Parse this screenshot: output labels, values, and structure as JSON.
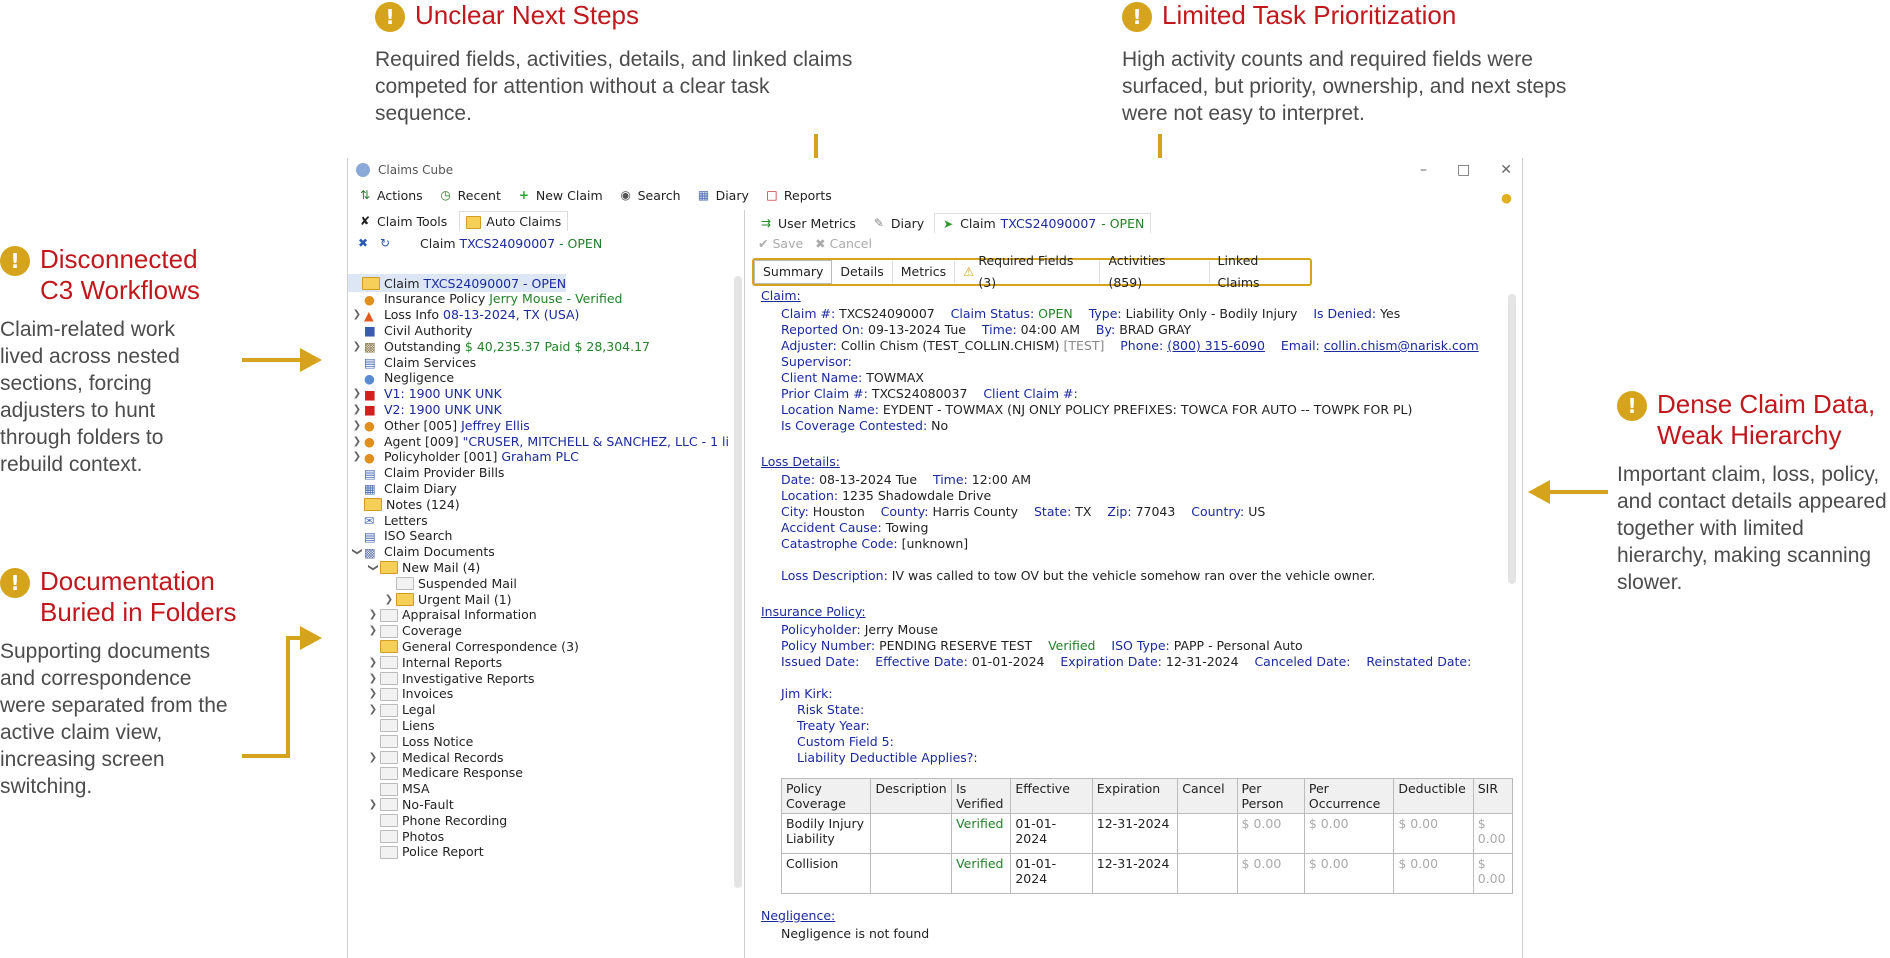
{
  "colors": {
    "accent": "#d5a31c",
    "annot_title": "#c0181c",
    "link": "#1a2a9c",
    "ok": "#24802a"
  },
  "annotations": {
    "unclear": {
      "title": "Unclear Next Steps",
      "desc": "Required fields, activities, details, and linked claims competed for attention without a clear task sequence."
    },
    "limited": {
      "title": "Limited Task Prioritization",
      "desc": "High activity counts and required fields were surfaced, but priority, ownership, and next steps were not easy to interpret."
    },
    "disconnected": {
      "title_1": "Disconnected",
      "title_2": "C3 Workflows",
      "desc": "Claim-related work lived across nested sections, forcing adjusters to hunt through folders to rebuild context."
    },
    "documentation": {
      "title_1": "Documentation",
      "title_2": "Buried in Folders",
      "desc": "Supporting documents and correspondence were separated from the active claim view, increasing screen switching."
    },
    "dense": {
      "title_1": "Dense Claim Data,",
      "title_2": "Weak Hierarchy",
      "desc": "Important claim, loss, policy, and contact details appeared together with limited hierarchy, making scanning slower."
    }
  },
  "window": {
    "title": "Claims Cube"
  },
  "toolbar": {
    "actions": "Actions",
    "recent": "Recent",
    "new_claim": "New Claim",
    "search": "Search",
    "diary": "Diary",
    "reports": "Reports"
  },
  "left_tabs": {
    "claim_tools": "Claim Tools",
    "auto_claims": "Auto Claims"
  },
  "left_sub": {
    "claim_label": "Claim",
    "claim_no": "TXCS24090007",
    "status": "- OPEN"
  },
  "tree": [
    {
      "label": "Claim",
      "extra": "TXCS24090007 - OPEN",
      "indent": 0,
      "chev": "",
      "icon": "folder-y",
      "extra_cls": "blue"
    },
    {
      "label": "Insurance Policy",
      "extra": "Jerry Mouse - Verified",
      "indent": 1,
      "chev": "",
      "icon": "person",
      "extra_cls": "green"
    },
    {
      "label": "Loss Info",
      "extra": "08-13-2024, TX (USA)",
      "indent": 1,
      "chev": ">",
      "icon": "cone",
      "extra_cls": "blue"
    },
    {
      "label": "Civil Authority",
      "extra": "",
      "indent": 1,
      "chev": "",
      "icon": "car"
    },
    {
      "label": "Outstanding",
      "extra": "$ 40,235.37   Paid $ 28,304.17",
      "indent": 1,
      "chev": ">",
      "icon": "money",
      "extra_cls": "green"
    },
    {
      "label": "Claim Services",
      "extra": "",
      "indent": 1,
      "chev": "",
      "icon": "doc"
    },
    {
      "label": "Negligence",
      "extra": "",
      "indent": 1,
      "chev": "",
      "icon": "people"
    },
    {
      "label": "V1:",
      "extra": "1900 UNK UNK",
      "indent": 1,
      "chev": ">",
      "icon": "redcar",
      "extra_cls": "blue",
      "label_cls": "blue"
    },
    {
      "label": "V2:",
      "extra": "1900 UNK UNK",
      "indent": 1,
      "chev": ">",
      "icon": "redcar",
      "extra_cls": "blue",
      "label_cls": "blue"
    },
    {
      "label": "Other [005]",
      "extra": "Jeffrey Ellis",
      "indent": 1,
      "chev": ">",
      "icon": "person",
      "extra_cls": "blue"
    },
    {
      "label": "Agent [009]",
      "extra": "\"CRUSER, MITCHELL & SANCHEZ, LLC - 1 li",
      "indent": 1,
      "chev": ">",
      "icon": "person",
      "extra_cls": "blue"
    },
    {
      "label": "Policyholder [001]",
      "extra": "Graham PLC",
      "indent": 1,
      "chev": ">",
      "icon": "person",
      "extra_cls": "blue"
    },
    {
      "label": "Claim Provider Bills",
      "extra": "",
      "indent": 1,
      "chev": "",
      "icon": "doc"
    },
    {
      "label": "Claim Diary",
      "extra": "",
      "indent": 1,
      "chev": "",
      "icon": "cal"
    },
    {
      "label": "Notes (124)",
      "extra": "",
      "indent": 1,
      "chev": "",
      "icon": "folder-y"
    },
    {
      "label": "Letters",
      "extra": "",
      "indent": 1,
      "chev": "",
      "icon": "mail"
    },
    {
      "label": "ISO Search",
      "extra": "",
      "indent": 1,
      "chev": "",
      "icon": "doc"
    },
    {
      "label": "Claim Documents",
      "extra": "",
      "indent": 1,
      "chev": "v",
      "icon": "cabinet"
    },
    {
      "label": "New Mail (4)",
      "extra": "",
      "indent": 2,
      "chev": "v",
      "icon": "folder-y"
    },
    {
      "label": "Suspended Mail",
      "extra": "",
      "indent": 3,
      "chev": "",
      "icon": "folder"
    },
    {
      "label": "Urgent Mail (1)",
      "extra": "",
      "indent": 3,
      "chev": ">",
      "icon": "folder-y"
    },
    {
      "label": "Appraisal Information",
      "extra": "",
      "indent": 2,
      "chev": ">",
      "icon": "folder"
    },
    {
      "label": "Coverage",
      "extra": "",
      "indent": 2,
      "chev": ">",
      "icon": "folder"
    },
    {
      "label": "General Correspondence (3)",
      "extra": "",
      "indent": 2,
      "chev": "",
      "icon": "folder-y"
    },
    {
      "label": "Internal Reports",
      "extra": "",
      "indent": 2,
      "chev": ">",
      "icon": "folder"
    },
    {
      "label": "Investigative Reports",
      "extra": "",
      "indent": 2,
      "chev": ">",
      "icon": "folder"
    },
    {
      "label": "Invoices",
      "extra": "",
      "indent": 2,
      "chev": ">",
      "icon": "folder"
    },
    {
      "label": "Legal",
      "extra": "",
      "indent": 2,
      "chev": ">",
      "icon": "folder"
    },
    {
      "label": "Liens",
      "extra": "",
      "indent": 2,
      "chev": "",
      "icon": "folder"
    },
    {
      "label": "Loss Notice",
      "extra": "",
      "indent": 2,
      "chev": "",
      "icon": "folder"
    },
    {
      "label": "Medical Records",
      "extra": "",
      "indent": 2,
      "chev": ">",
      "icon": "folder"
    },
    {
      "label": "Medicare Response",
      "extra": "",
      "indent": 2,
      "chev": "",
      "icon": "folder"
    },
    {
      "label": "MSA",
      "extra": "",
      "indent": 2,
      "chev": "",
      "icon": "folder"
    },
    {
      "label": "No-Fault",
      "extra": "",
      "indent": 2,
      "chev": ">",
      "icon": "folder"
    },
    {
      "label": "Phone Recording",
      "extra": "",
      "indent": 2,
      "chev": "",
      "icon": "folder"
    },
    {
      "label": "Photos",
      "extra": "",
      "indent": 2,
      "chev": "",
      "icon": "folder"
    },
    {
      "label": "Police Report",
      "extra": "",
      "indent": 2,
      "chev": "",
      "icon": "folder"
    }
  ],
  "right_tabs": {
    "user_metrics": "User Metrics",
    "diary": "Diary",
    "claim": "Claim",
    "claim_no": "TXCS24090007",
    "status": "- OPEN"
  },
  "actions": {
    "save": "Save",
    "cancel": "Cancel"
  },
  "subtabs": [
    "Summary",
    "Details",
    "Metrics",
    "Required Fields (3)",
    "Activities (859)",
    "Linked Claims"
  ],
  "summary": {
    "claim_header": "Claim:",
    "claim_no_label": "Claim #:",
    "claim_no": "TXCS24090007",
    "status_label": "Claim Status:",
    "status": "OPEN",
    "type_label": "Type:",
    "type": "Liability Only - Bodily Injury",
    "denied_label": "Is Denied:",
    "denied": "Yes",
    "reported_label": "Reported On:",
    "reported": "09-13-2024 Tue",
    "time_label": "Time:",
    "time": "04:00 AM",
    "by_label": "By:",
    "by": "BRAD GRAY",
    "adjuster_label": "Adjuster:",
    "adjuster": "Collin Chism (TEST_COLLIN.CHISM)",
    "adjuster_tag": "[TEST]",
    "phone_label": "Phone:",
    "phone": "(800) 315-6090",
    "email_label": "Email:",
    "email": "collin.chism@narisk.com",
    "supervisor_label": "Supervisor:",
    "client_label": "Client Name:",
    "client": "TOWMAX",
    "prior_label": "Prior Claim #:",
    "prior": "TXCS24080037",
    "client_claim_label": "Client Claim #:",
    "location_label": "Location Name:",
    "location": "EYDENT - TOWMAX (NJ ONLY POLICY PREFIXES: TOWCA FOR AUTO -- TOWPK FOR PL)",
    "contested_label": "Is Coverage Contested:",
    "contested": "No",
    "loss_header": "Loss Details:",
    "date_label": "Date:",
    "date": "08-13-2024 Tue",
    "ltime_label": "Time:",
    "ltime": "12:00 AM",
    "loc_label": "Location:",
    "loc": "1235 Shadowdale Drive",
    "city_label": "City:",
    "city": "Houston",
    "county_label": "County:",
    "county": "Harris County",
    "state_label": "State:",
    "state": "TX",
    "zip_label": "Zip:",
    "zip": "77043",
    "country_label": "Country:",
    "country": "US",
    "cause_label": "Accident Cause:",
    "cause": "Towing",
    "cat_label": "Catastrophe Code:",
    "cat": "[unknown]",
    "desc_label": "Loss Description:",
    "desc": "IV was called to tow OV but the vehicle somehow ran over the vehicle owner.",
    "policy_header": "Insurance Policy:",
    "holder_label": "Policyholder:",
    "holder": "Jerry Mouse",
    "pnum_label": "Policy Number:",
    "pnum": "PENDING RESERVE TEST",
    "pverified": "Verified",
    "iso_label": "ISO Type:",
    "iso": "PAPP - Personal Auto",
    "issued_label": "Issued Date:",
    "eff_label": "Effective Date:",
    "eff": "01-01-2024",
    "exp_label": "Expiration Date:",
    "exp": "12-31-2024",
    "canc_label": "Canceled Date:",
    "reinst_label": "Reinstated Date:",
    "kirk": "Jim Kirk:",
    "risk": "Risk State:",
    "treaty": "Treaty Year:",
    "custom5": "Custom Field 5:",
    "deductible": "Liability Deductible Applies?:",
    "negligence_header": "Negligence:",
    "negligence_text": "Negligence is not found"
  },
  "table": {
    "headers": [
      "Policy Coverage",
      "Description",
      "Is Verified",
      "Effective",
      "Expiration",
      "Cancel",
      "Per Person",
      "Per Occurrence",
      "Deductible",
      "SIR"
    ],
    "rows": [
      [
        "Bodily Injury Liability",
        "",
        "Verified",
        "01-01-2024",
        "12-31-2024",
        "",
        "$ 0.00",
        "$ 0.00",
        "$ 0.00",
        "$ 0.00"
      ],
      [
        "Collision",
        "",
        "Verified",
        "01-01-2024",
        "12-31-2024",
        "",
        "$ 0.00",
        "$ 0.00",
        "$ 0.00",
        "$ 0.00"
      ]
    ]
  }
}
